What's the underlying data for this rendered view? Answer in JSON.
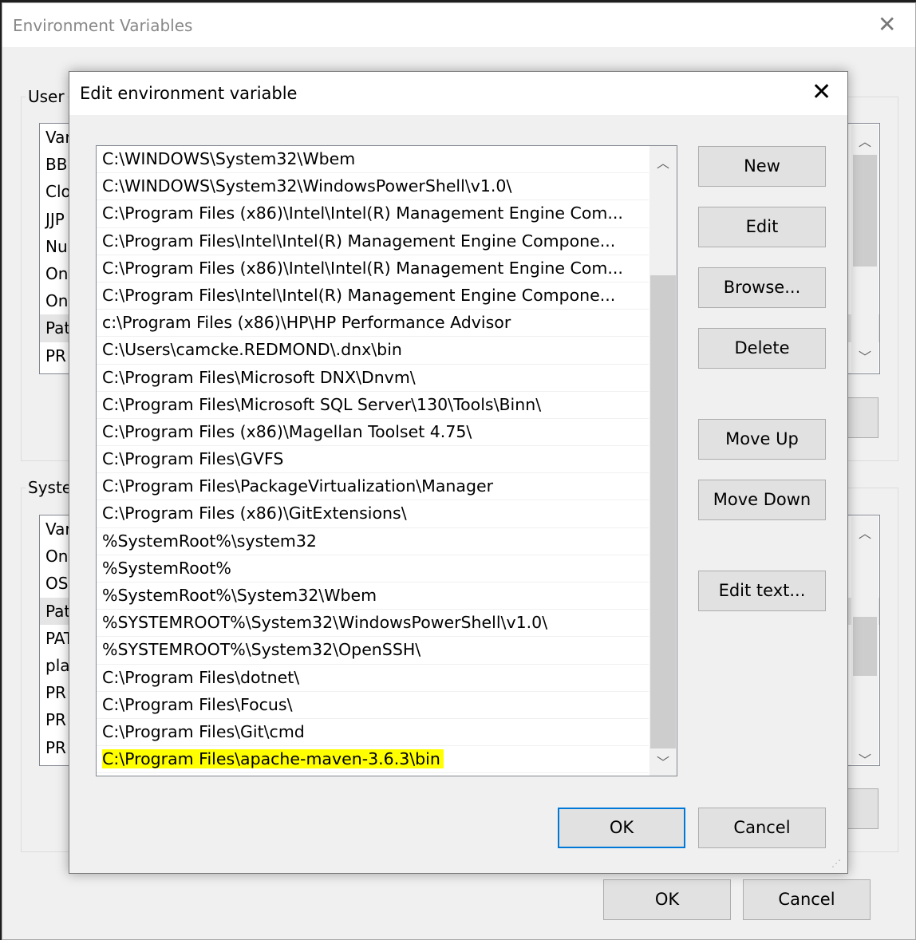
{
  "outer": {
    "title": "Environment Variables",
    "user_group_label": "User",
    "system_group_label": "Syste",
    "user_vars": [
      "Var",
      "BB",
      "Clo",
      "JJP",
      "Nu",
      "On",
      "On",
      "Pat",
      "PR"
    ],
    "system_vars": [
      "Var",
      "On",
      "OS",
      "Pat",
      "PAT",
      "pla",
      "PR",
      "PR",
      "PR"
    ],
    "ok_label": "OK",
    "cancel_label": "Cancel"
  },
  "dialog": {
    "title": "Edit environment variable",
    "paths": [
      "C:\\WINDOWS\\System32\\Wbem",
      "C:\\WINDOWS\\System32\\WindowsPowerShell\\v1.0\\",
      "C:\\Program Files (x86)\\Intel\\Intel(R) Management Engine Com...",
      "C:\\Program Files\\Intel\\Intel(R) Management Engine Compone...",
      "C:\\Program Files (x86)\\Intel\\Intel(R) Management Engine Com...",
      "C:\\Program Files\\Intel\\Intel(R) Management Engine Compone...",
      "c:\\Program Files (x86)\\HP\\HP Performance Advisor",
      "C:\\Users\\camcke.REDMOND\\.dnx\\bin",
      "C:\\Program Files\\Microsoft DNX\\Dnvm\\",
      "C:\\Program Files\\Microsoft SQL Server\\130\\Tools\\Binn\\",
      "C:\\Program Files (x86)\\Magellan Toolset 4.75\\",
      "C:\\Program Files\\GVFS",
      "C:\\Program Files\\PackageVirtualization\\Manager",
      "C:\\Program Files (x86)\\GitExtensions\\",
      "%SystemRoot%\\system32",
      "%SystemRoot%",
      "%SystemRoot%\\System32\\Wbem",
      "%SYSTEMROOT%\\System32\\WindowsPowerShell\\v1.0\\",
      "%SYSTEMROOT%\\System32\\OpenSSH\\",
      "C:\\Program Files\\dotnet\\",
      "C:\\Program Files\\Focus\\",
      "C:\\Program Files\\Git\\cmd",
      "C:\\Program Files\\apache-maven-3.6.3\\bin"
    ],
    "highlighted_index": 22,
    "highlight_color": "#ffff00",
    "buttons": {
      "new": "New",
      "edit": "Edit",
      "browse": "Browse...",
      "delete": "Delete",
      "move_up": "Move Up",
      "move_down": "Move Down",
      "edit_text": "Edit text...",
      "ok": "OK",
      "cancel": "Cancel"
    }
  }
}
